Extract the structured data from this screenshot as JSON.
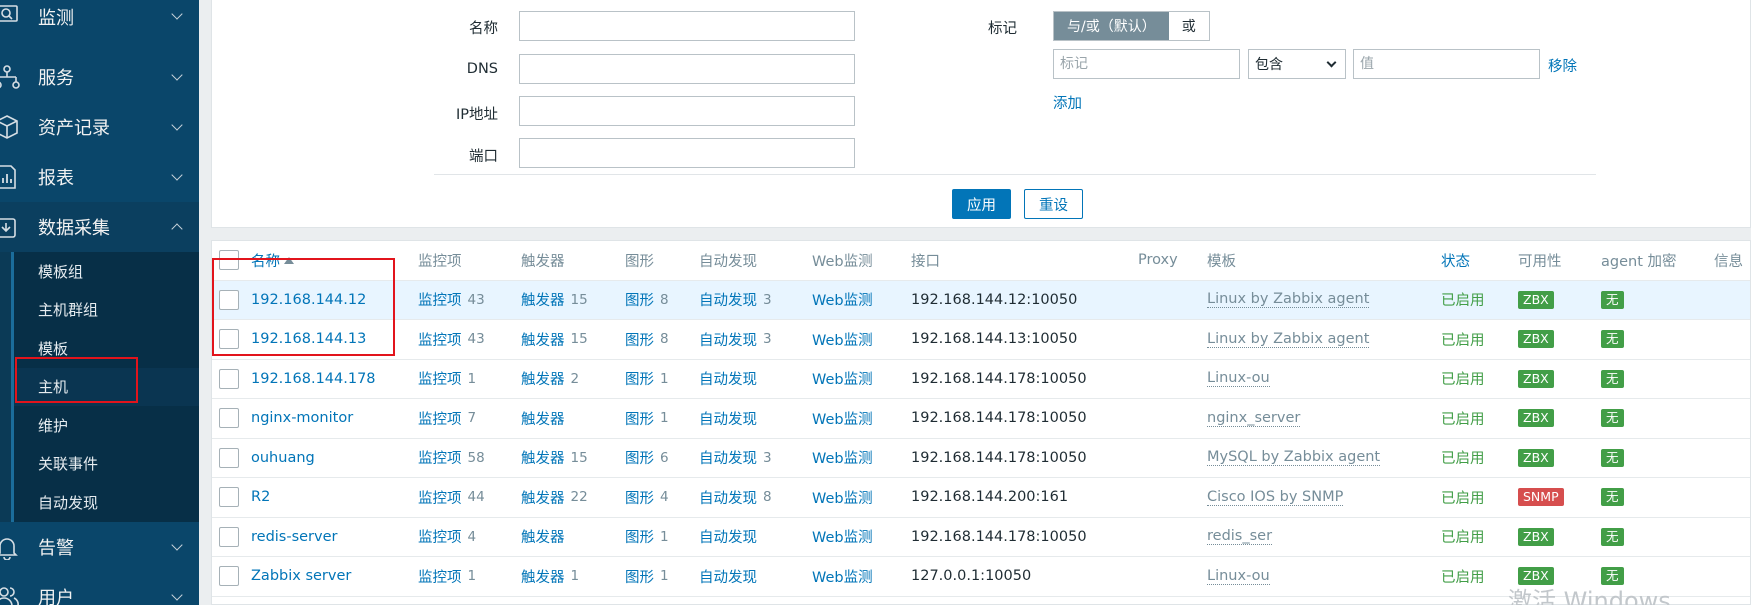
{
  "sidebar": {
    "menus": [
      {
        "label": "监测",
        "icon": "monitoring-icon"
      },
      {
        "label": "服务",
        "icon": "services-icon"
      },
      {
        "label": "资产记录",
        "icon": "inventory-icon"
      },
      {
        "label": "报表",
        "icon": "reports-icon"
      },
      {
        "label": "数据采集",
        "icon": "data-collection-icon"
      },
      {
        "label": "告警",
        "icon": "bell-icon"
      },
      {
        "label": "用户",
        "icon": "users-icon"
      }
    ],
    "submenu": [
      "模板组",
      "主机群组",
      "模板",
      "主机",
      "维护",
      "关联事件",
      "自动发现"
    ]
  },
  "filter": {
    "name_label": "名称",
    "dns_label": "DNS",
    "ip_label": "IP地址",
    "port_label": "端口",
    "tags_label": "标记",
    "tag_andor": "与/或（默认）",
    "tag_or": "或",
    "tag_placeholder": "标记",
    "tag_operator": "包含",
    "value_placeholder": "值",
    "remove": "移除",
    "add": "添加",
    "apply": "应用",
    "reset": "重设"
  },
  "table": {
    "headers": {
      "name": "名称",
      "items": "监控项",
      "triggers": "触发器",
      "graphs": "图形",
      "discovery": "自动发现",
      "web": "Web监测",
      "interface": "接口",
      "proxy": "Proxy",
      "templates": "模板",
      "status": "状态",
      "availability": "可用性",
      "encryption": "agent 加密",
      "info": "信息"
    },
    "rows": [
      {
        "name": "192.168.144.12",
        "items": "监控项",
        "items_count": "43",
        "triggers": "触发器",
        "triggers_count": "15",
        "graphs": "图形",
        "graphs_count": "8",
        "discovery": "自动发现",
        "discovery_count": "3",
        "web": "Web监测",
        "interface": "192.168.144.12:10050",
        "template": "Linux by Zabbix agent",
        "status": "已启用",
        "availability": "ZBX",
        "encryption": "无"
      },
      {
        "name": "192.168.144.13",
        "items": "监控项",
        "items_count": "43",
        "triggers": "触发器",
        "triggers_count": "15",
        "graphs": "图形",
        "graphs_count": "8",
        "discovery": "自动发现",
        "discovery_count": "3",
        "web": "Web监测",
        "interface": "192.168.144.13:10050",
        "template": "Linux by Zabbix agent",
        "status": "已启用",
        "availability": "ZBX",
        "encryption": "无"
      },
      {
        "name": "192.168.144.178",
        "items": "监控项",
        "items_count": "1",
        "triggers": "触发器",
        "triggers_count": "2",
        "graphs": "图形",
        "graphs_count": "1",
        "discovery": "自动发现",
        "discovery_count": "",
        "web": "Web监测",
        "interface": "192.168.144.178:10050",
        "template": "Linux-ou",
        "status": "已启用",
        "availability": "ZBX",
        "encryption": "无"
      },
      {
        "name": "nginx-monitor",
        "items": "监控项",
        "items_count": "7",
        "triggers": "触发器",
        "triggers_count": "",
        "graphs": "图形",
        "graphs_count": "1",
        "discovery": "自动发现",
        "discovery_count": "",
        "web": "Web监测",
        "interface": "192.168.144.178:10050",
        "template": "nginx_server",
        "status": "已启用",
        "availability": "ZBX",
        "encryption": "无"
      },
      {
        "name": "ouhuang",
        "items": "监控项",
        "items_count": "58",
        "triggers": "触发器",
        "triggers_count": "15",
        "graphs": "图形",
        "graphs_count": "6",
        "discovery": "自动发现",
        "discovery_count": "3",
        "web": "Web监测",
        "interface": "192.168.144.178:10050",
        "template": "MySQL by Zabbix agent",
        "status": "已启用",
        "availability": "ZBX",
        "encryption": "无"
      },
      {
        "name": "R2",
        "items": "监控项",
        "items_count": "44",
        "triggers": "触发器",
        "triggers_count": "22",
        "graphs": "图形",
        "graphs_count": "4",
        "discovery": "自动发现",
        "discovery_count": "8",
        "web": "Web监测",
        "interface": "192.168.144.200:161",
        "template": "Cisco IOS by SNMP",
        "status": "已启用",
        "availability": "SNMP",
        "encryption": "无"
      },
      {
        "name": "redis-server",
        "items": "监控项",
        "items_count": "4",
        "triggers": "触发器",
        "triggers_count": "",
        "graphs": "图形",
        "graphs_count": "1",
        "discovery": "自动发现",
        "discovery_count": "",
        "web": "Web监测",
        "interface": "192.168.144.178:10050",
        "template": "redis_ser",
        "status": "已启用",
        "availability": "ZBX",
        "encryption": "无"
      },
      {
        "name": "Zabbix server",
        "items": "监控项",
        "items_count": "1",
        "triggers": "触发器",
        "triggers_count": "1",
        "graphs": "图形",
        "graphs_count": "1",
        "discovery": "自动发现",
        "discovery_count": "",
        "web": "Web监测",
        "interface": "127.0.0.1:10050",
        "template": "Linux-ou",
        "status": "已启用",
        "availability": "ZBX",
        "encryption": "无"
      }
    ]
  },
  "watermark": "激活 Windows",
  "colors": {
    "sidebar": "#0a466a",
    "link": "#0275b8",
    "enabled": "#429e47",
    "zbx": "#429e47",
    "snmp": "#d64e4e",
    "highlight": "#e2141c"
  }
}
